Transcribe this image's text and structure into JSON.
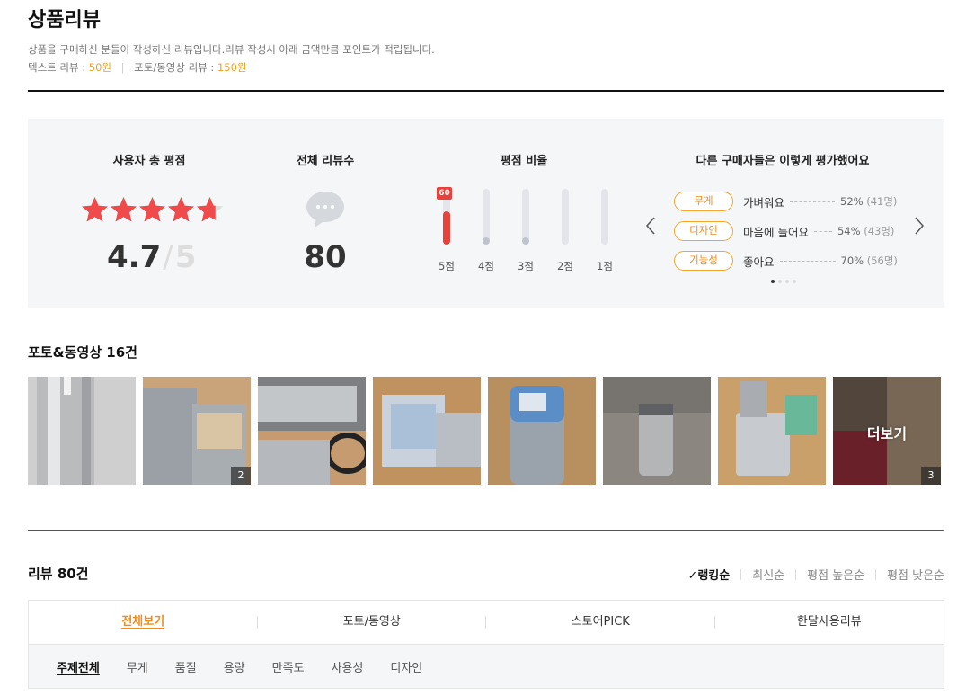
{
  "header": {
    "title": "상품리뷰",
    "description": "상품을 구매하신 분들이 작성하신 리뷰입니다.리뷰 작성시 아래 금액만큼 포인트가 적립됩니다.",
    "text_review_label": "텍스트 리뷰 :",
    "text_review_amount": "50원",
    "photo_review_label": "포토/동영상 리뷰 :",
    "photo_review_amount": "150원"
  },
  "summary": {
    "rating_title": "사용자 총 평점",
    "rating_value": "4.7",
    "rating_slash": "/",
    "rating_max": "5",
    "rating_numeric": 4.7,
    "count_title": "전체 리뷰수",
    "count_value": "80",
    "ratio_title": "평점 비율",
    "ratio_bars": [
      {
        "label": "5점",
        "percent": 60,
        "badge": "60"
      },
      {
        "label": "4점",
        "percent": 12
      },
      {
        "label": "3점",
        "percent": 12
      },
      {
        "label": "2점",
        "percent": 0
      },
      {
        "label": "1점",
        "percent": 0
      }
    ],
    "evaluation_title": "다른 구매자들은 이렇게 평가했어요",
    "evaluations": [
      {
        "tag": "무게",
        "text": "가벼워요",
        "percent": "52%",
        "count": "(41명)"
      },
      {
        "tag": "디자인",
        "text": "마음에 들어요",
        "percent": "54%",
        "count": "(43명)"
      },
      {
        "tag": "기능성",
        "text": "좋아요",
        "percent": "70%",
        "count": "(56명)"
      }
    ],
    "page_dots": 4,
    "active_dot": 0
  },
  "photos": {
    "title": "포토&동영상 16건",
    "items": [
      {
        "count": ""
      },
      {
        "count": "2"
      },
      {
        "count": ""
      },
      {
        "count": ""
      },
      {
        "count": ""
      },
      {
        "count": ""
      },
      {
        "count": ""
      },
      {
        "count": "3",
        "more_label": "더보기"
      }
    ]
  },
  "reviews": {
    "title": "리뷰 80건",
    "sort_options": [
      "랭킹순",
      "최신순",
      "평점 높은순",
      "평점 낮은순"
    ],
    "tabs": [
      "전체보기",
      "포토/동영상",
      "스토어PICK",
      "한달사용리뷰"
    ],
    "topics": [
      "주제전체",
      "무게",
      "품질",
      "용량",
      "만족도",
      "사용성",
      "디자인"
    ]
  },
  "colors": {
    "star": "#f04a4a",
    "accent": "#f08c1c",
    "bar": "#e8413c"
  }
}
